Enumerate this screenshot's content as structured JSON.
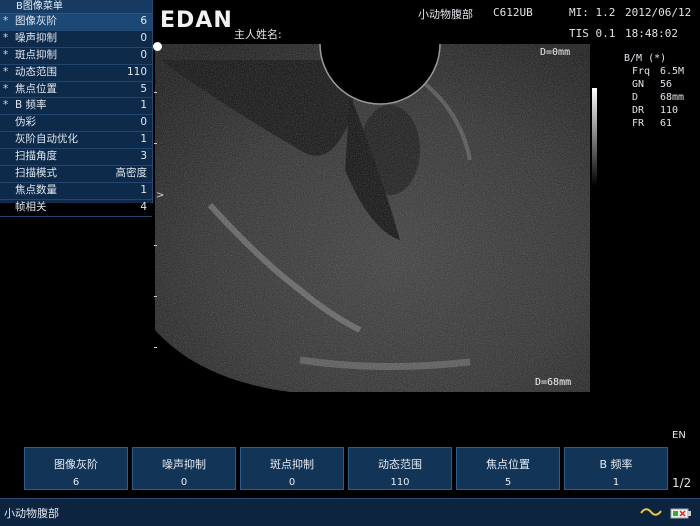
{
  "menu": {
    "title": "B图像菜单",
    "items": [
      {
        "mark": "*",
        "label": "图像灰阶",
        "value": "6"
      },
      {
        "mark": "*",
        "label": "噪声抑制",
        "value": "0"
      },
      {
        "mark": "*",
        "label": "斑点抑制",
        "value": "0"
      },
      {
        "mark": "*",
        "label": "动态范围",
        "value": "110"
      },
      {
        "mark": "*",
        "label": "焦点位置",
        "value": "5"
      },
      {
        "mark": "*",
        "label": "B 频率",
        "value": "1"
      },
      {
        "mark": "",
        "label": "伪彩",
        "value": "0"
      },
      {
        "mark": "",
        "label": "灰阶自动优化",
        "value": "1"
      },
      {
        "mark": "",
        "label": "扫描角度",
        "value": "3"
      },
      {
        "mark": "",
        "label": "扫描模式",
        "value": "高密度"
      },
      {
        "mark": "",
        "label": "焦点数量",
        "value": "1"
      },
      {
        "mark": "",
        "label": "帧相关",
        "value": "4"
      }
    ]
  },
  "header": {
    "logo": "EDAN",
    "patient_label": "主人姓名:",
    "exam": "小动物腹部",
    "probe": "C612UB",
    "mi": "MI: 1.2",
    "date": "2012/06/12",
    "tis": "TIS 0.1",
    "time": "18:48:02"
  },
  "image": {
    "depth_top": "D=0mm",
    "depth_bottom": "D=68mm",
    "focus_marker": ">"
  },
  "right_params": {
    "mode": "B/M (*)",
    "items": [
      {
        "key": "Frq",
        "value": "6.5M"
      },
      {
        "key": "GN",
        "value": "56"
      },
      {
        "key": "D",
        "value": "68mm"
      },
      {
        "key": "DR",
        "value": "110"
      },
      {
        "key": "FR",
        "value": "61"
      }
    ]
  },
  "lang": "EN",
  "page_indicator": "1/2",
  "softkeys": [
    {
      "label": "图像灰阶",
      "value": "6"
    },
    {
      "label": "噪声抑制",
      "value": "0"
    },
    {
      "label": "斑点抑制",
      "value": "0"
    },
    {
      "label": "动态范围",
      "value": "110"
    },
    {
      "label": "焦点位置",
      "value": "5"
    },
    {
      "label": "B 频率",
      "value": "1"
    }
  ],
  "status": {
    "exam": "小动物腹部"
  },
  "icons": {
    "wave": "wave-icon",
    "battery": "battery-icon"
  }
}
